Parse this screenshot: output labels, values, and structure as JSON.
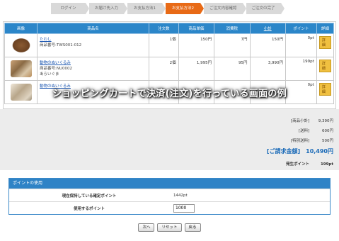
{
  "steps": [
    "ログイン",
    "お届け先入力",
    "お支払方法1",
    "お支払方法2",
    "ご注文内容確認",
    "ご注文の完了"
  ],
  "active_step_index": 3,
  "cart": {
    "headers": [
      "画像",
      "商品名",
      "注文数",
      "商品単価",
      "消費税",
      "小計",
      "ポイント",
      "詳細"
    ],
    "subtotal_header_is_link": true,
    "rows": [
      {
        "name": "たわし",
        "code": "商品番号:TWS001-012",
        "qty": "1個",
        "unit_price": "150円",
        "tax": "7円",
        "subtotal": "150円",
        "points": "0pt",
        "detail": "詳細"
      },
      {
        "name": "動物のぬいぐるみ",
        "code": "商品番号:NU0002",
        "variant": "あらいぐま",
        "qty": "2個",
        "unit_price": "1,995円",
        "tax": "95円",
        "subtotal": "3,990円",
        "points": "199pt",
        "detail": "詳細"
      },
      {
        "name": "動物のぬいぐるみ",
        "code": "",
        "qty": "",
        "unit_price": "",
        "tax": "",
        "subtotal": "",
        "points": "0pt",
        "detail": "詳細"
      }
    ]
  },
  "overlay_caption": "ショッピングカートで決済(注文)を行っている画面の例",
  "summary": {
    "items_total_label": "[商品小計]",
    "items_total": "9,390円",
    "shipping_label": "[送料]",
    "shipping": "600円",
    "special_label": "[特別送料]",
    "special": "500円",
    "grand_label": "[ご請求金額]",
    "grand": "10,490円",
    "points_label": "発生ポイント",
    "points": "199pt"
  },
  "points_section": {
    "title": "ポイントの使用",
    "held_label": "現在保持している確定ポイント",
    "held_value": "1442pt",
    "use_label": "使用するポイント",
    "use_value": "1000"
  },
  "buttons": {
    "next": "次へ",
    "reset": "リセット",
    "back": "戻る"
  },
  "colors": {
    "header_blue": "#2b86c9",
    "active_step": "#e86a16",
    "link": "#1a55b0",
    "grand_total": "#1a6ab8"
  }
}
